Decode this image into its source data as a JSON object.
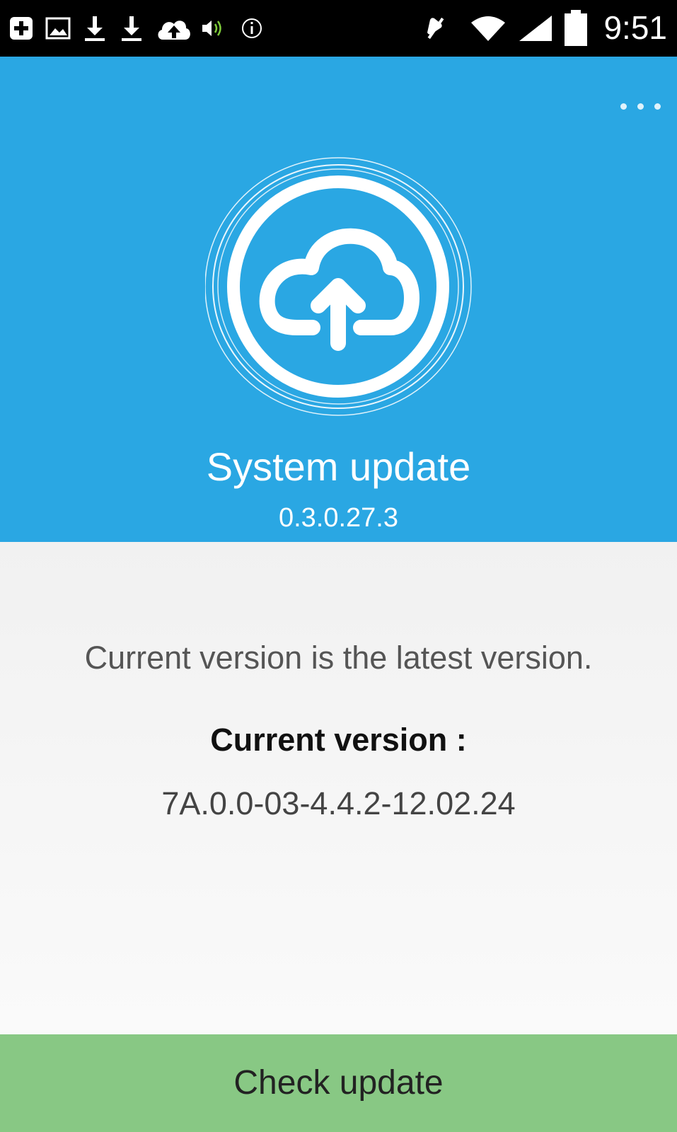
{
  "status_bar": {
    "time": "9:51",
    "icons": [
      "add-notification-icon",
      "image-notification-icon",
      "download-icon",
      "download-icon",
      "cloud-upload-notification-icon",
      "volume-icon",
      "info-icon",
      "mute-icon",
      "wifi-icon",
      "signal-icon",
      "battery-icon"
    ]
  },
  "header": {
    "title": "System update",
    "version": "0.3.0.27.3",
    "menu_icon": "overflow-menu-icon",
    "logo_icon": "cloud-upload-icon"
  },
  "main": {
    "status_message": "Current version is the latest version.",
    "current_version_label": "Current version :",
    "current_version_value": "7A.0.0-03-4.4.2-12.02.24"
  },
  "footer": {
    "check_button_label": "Check update"
  },
  "colors": {
    "header_bg": "#2aa7e3",
    "button_bg": "#88c884",
    "content_bg": "#f3f3f3",
    "status_bar_bg": "#000000"
  }
}
